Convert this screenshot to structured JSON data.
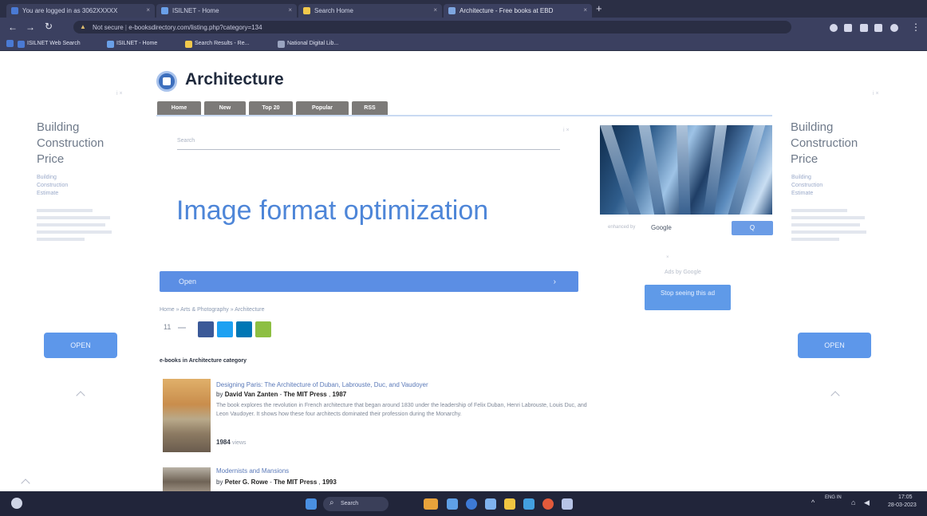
{
  "browser": {
    "tabs": [
      {
        "label": "You are logged in as 3062XXXXX",
        "color": "#4a7ad4",
        "active": false
      },
      {
        "label": "ISILNET - Home",
        "color": "#6aa0e8",
        "active": false
      },
      {
        "label": "Search Home",
        "color": "#f2c94c",
        "active": false
      },
      {
        "label": "Architecture - Free books at EBD",
        "color": "#7ea6e0",
        "active": true
      }
    ],
    "new_tab": "+",
    "omnibox": {
      "security": "Not secure",
      "url": "e-booksdirectory.com/listing.php?category=134"
    },
    "bookmarks": [
      {
        "label": "ISILNET Web Search",
        "color": "#4a7ad4"
      },
      {
        "label": "ISILNET - Home",
        "color": "#6aa0e8"
      },
      {
        "label": "Search Results - Re...",
        "color": "#f2c94c"
      },
      {
        "label": "National Digital Lib...",
        "color": "#9aa4c0"
      }
    ]
  },
  "sidebar_ad": {
    "title_lines": [
      "Building",
      "Construction",
      "Price"
    ],
    "sub_lines": [
      "Building",
      "Construction",
      "Estimate"
    ],
    "open_label": "OPEN",
    "ad_marker": "i ×"
  },
  "site": {
    "title": "Architecture",
    "nav": [
      "Home",
      "New",
      "Top 20",
      "Popular",
      "RSS"
    ]
  },
  "main_ad": {
    "search_placeholder": "Search",
    "headline": "Image format optimization",
    "open_label": "Open",
    "open_chevron": "›",
    "close_marker": "i ×"
  },
  "image_ad": {
    "search_label": "enhanced by",
    "google_label": "Google",
    "search_button": "Q",
    "ad_x": "×",
    "ads_by": "Ads by Google",
    "stop_label": "Stop seeing this ad"
  },
  "page": {
    "breadcrumb": "Home » Arts & Photography » Architecture",
    "likes": "11",
    "share_colors": [
      "#3b5998",
      "#1da1f2",
      "#0077b5",
      "#8dbf42"
    ],
    "books_heading": "e-books in Architecture category",
    "books": [
      {
        "title": "Designing Paris: The Architecture of Duban, Labrouste, Duc, and Vaudoyer",
        "by_prefix": "by",
        "author": "David Van Zanten",
        "publisher": "The MIT Press",
        "year": "1987",
        "description": "The book explores the revolution in French architecture that began around 1830 under the leadership of Felix Duban, Henri Labrouste, Louis Duc, and Leon Vaudoyer. It shows how these four architects dominated their profession during the Monarchy.",
        "pages": "1984",
        "views_label": "views"
      },
      {
        "title": "Modernists and Mansions",
        "by_prefix": "by",
        "author": "Peter G. Rowe",
        "publisher": "The MIT Press",
        "year": "1993"
      }
    ]
  },
  "taskbar": {
    "search_label": "Search",
    "app_colors": [
      "#4a90e2",
      "#e8a33b",
      "#5fa0e6",
      "#3d7ad6",
      "#f0c541",
      "#7fb2ee",
      "#43a0e0",
      "#e25a3b",
      "#b7c4e6"
    ],
    "tray_lang": "ENG IN",
    "time": "17:05",
    "date": "28-03-2023"
  },
  "colors": {
    "accent": "#5b8ee4",
    "nav_tab": "#7c7a78",
    "link": "#5a79b8"
  }
}
